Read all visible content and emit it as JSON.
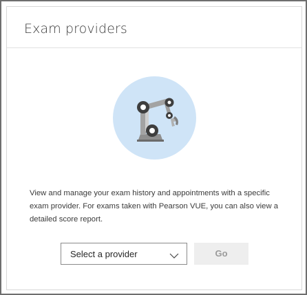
{
  "card": {
    "title": "Exam providers",
    "illustration_icon": "robot-arm-icon",
    "description": "View and manage your exam history and appointments with a specific exam provider. For exams taken with Pearson VUE, you can also view a detailed score report."
  },
  "provider_select": {
    "selected_label": "Select a provider",
    "icon": "chevron-down-icon"
  },
  "go_button": {
    "label": "Go",
    "state": "disabled"
  },
  "colors": {
    "illustration_circle": "#cfe4f7",
    "arm_dark": "#3e3e3e",
    "arm_light": "#9a9a9a",
    "button_disabled_bg": "#eeeeee",
    "button_disabled_text": "#9a9a9a"
  }
}
